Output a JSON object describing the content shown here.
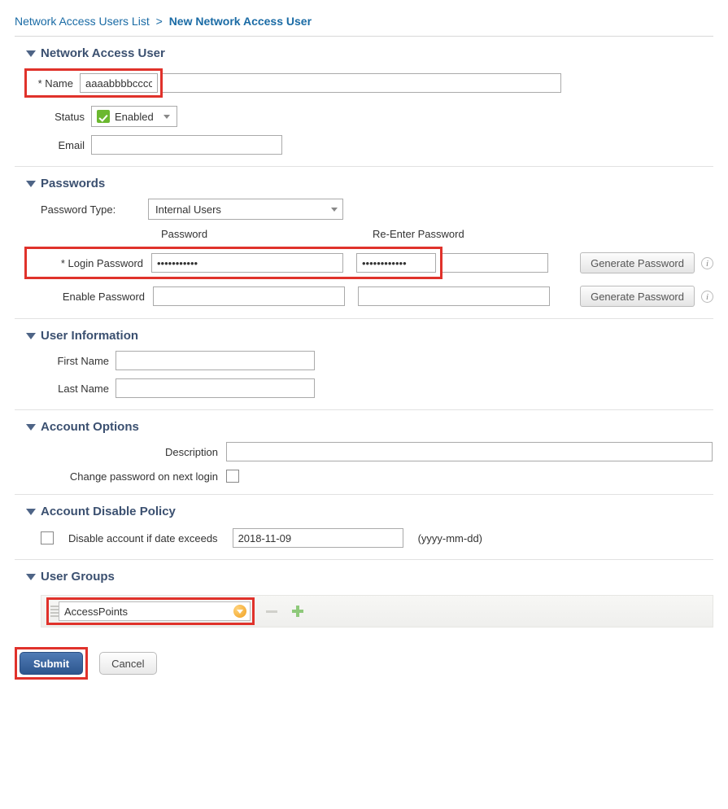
{
  "breadcrumb": {
    "link": "Network Access Users List",
    "sep": ">",
    "current": "New Network Access User"
  },
  "sections": {
    "user": "Network Access User",
    "passwords": "Passwords",
    "userinfo": "User Information",
    "acctopts": "Account Options",
    "adp": "Account Disable Policy",
    "groups": "User Groups"
  },
  "labels": {
    "name": "* Name",
    "status": "Status",
    "email": "Email",
    "pwd_type": "Password Type:",
    "col_pwd": "Password",
    "col_repwd": "Re-Enter Password",
    "login_pwd": "* Login Password",
    "enable_pwd": "Enable Password",
    "gen_pwd": "Generate Password",
    "first_name": "First Name",
    "last_name": "Last Name",
    "description": "Description",
    "change_on_next": "Change password on next login",
    "disable_if_date": "Disable account if date exceeds",
    "date_hint": "(yyyy-mm-dd)"
  },
  "values": {
    "name": "aaaabbbbcccc",
    "status": "Enabled",
    "email": "",
    "pwd_type": "Internal Users",
    "login_pwd": "•••••••••••",
    "login_repwd": "••••••••••••",
    "enable_pwd": "",
    "enable_repwd": "",
    "first_name": "",
    "last_name": "",
    "description": "",
    "change_on_next_checked": false,
    "disable_checked": false,
    "disable_date": "2018-11-09",
    "user_group": "AccessPoints"
  },
  "buttons": {
    "submit": "Submit",
    "cancel": "Cancel"
  }
}
